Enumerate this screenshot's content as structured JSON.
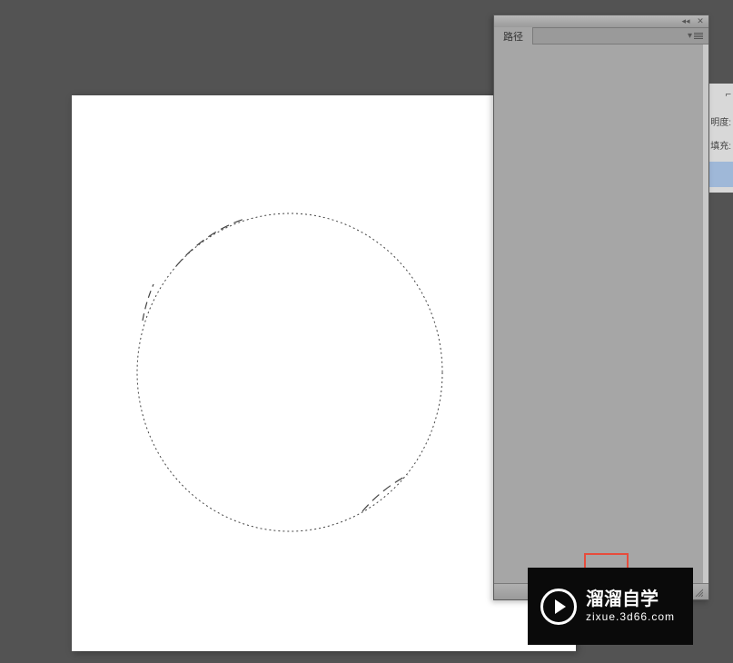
{
  "panel": {
    "tab_label": "路径",
    "collapse_glyph": "◂◂",
    "close_glyph": "✕",
    "menu_arrow": "▾"
  },
  "right_panel": {
    "opacity_label": "明度:",
    "fill_label": "填充:"
  },
  "watermark": {
    "main_text": "溜溜自学",
    "sub_text": "zixue.3d66.com"
  }
}
